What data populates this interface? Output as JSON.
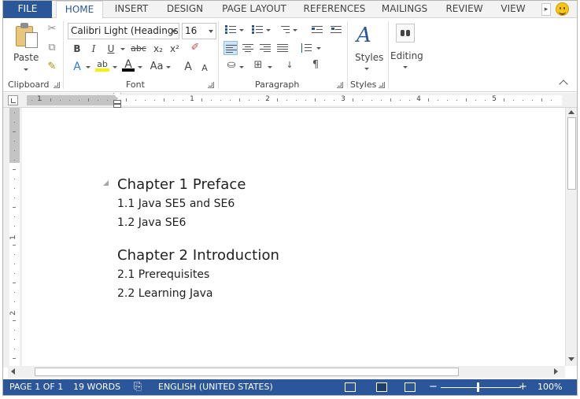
{
  "tabs": [
    {
      "label": "FILE"
    },
    {
      "label": "HOME"
    },
    {
      "label": "INSERT"
    },
    {
      "label": "DESIGN"
    },
    {
      "label": "PAGE LAYOUT"
    },
    {
      "label": "REFERENCES"
    },
    {
      "label": "MAILINGS"
    },
    {
      "label": "REVIEW"
    },
    {
      "label": "VIEW"
    }
  ],
  "active_tab": "HOME",
  "ribbon": {
    "clipboard": {
      "paste_label": "Paste",
      "group_label": "Clipboard"
    },
    "font": {
      "font_name": "Calibri Light (Headings)",
      "font_size": "16",
      "group_label": "Font",
      "bold": "B",
      "italic": "I",
      "underline": "U",
      "strike": "abc",
      "subscript": "x₂",
      "superscript": "x²",
      "text_effects": "A",
      "highlight": "ab",
      "font_color": "A",
      "change_case": "Aa",
      "grow": "A",
      "shrink": "A"
    },
    "paragraph": {
      "group_label": "Paragraph",
      "show_marks": "¶"
    },
    "styles": {
      "label": "Styles",
      "group_label": "Styles"
    },
    "editing": {
      "label": "Editing"
    }
  },
  "ruler": {
    "h_numbers": [
      "1",
      "1",
      "2",
      "3",
      "4",
      "5"
    ],
    "v_numbers": [
      "1",
      "2"
    ]
  },
  "document": {
    "lines": [
      {
        "text": "Chapter 1 Preface",
        "kind": "heading"
      },
      {
        "text": "1.1 Java SE5 and SE6",
        "kind": "sub"
      },
      {
        "text": "1.2 Java SE6",
        "kind": "sub"
      },
      {
        "text": "Chapter 2 Introduction",
        "kind": "heading"
      },
      {
        "text": "2.1 Prerequisites",
        "kind": "sub"
      },
      {
        "text": "2.2 Learning Java",
        "kind": "sub"
      }
    ]
  },
  "status": {
    "page": "PAGE 1 OF 1",
    "words": "19 WORDS",
    "language": "ENGLISH (UNITED STATES)",
    "zoom": "100%",
    "zoom_minus": "−",
    "zoom_plus": "+"
  },
  "colors": {
    "accent": "#2b579a",
    "status_bar": "#2b579a",
    "selection": "#cde6f7"
  }
}
